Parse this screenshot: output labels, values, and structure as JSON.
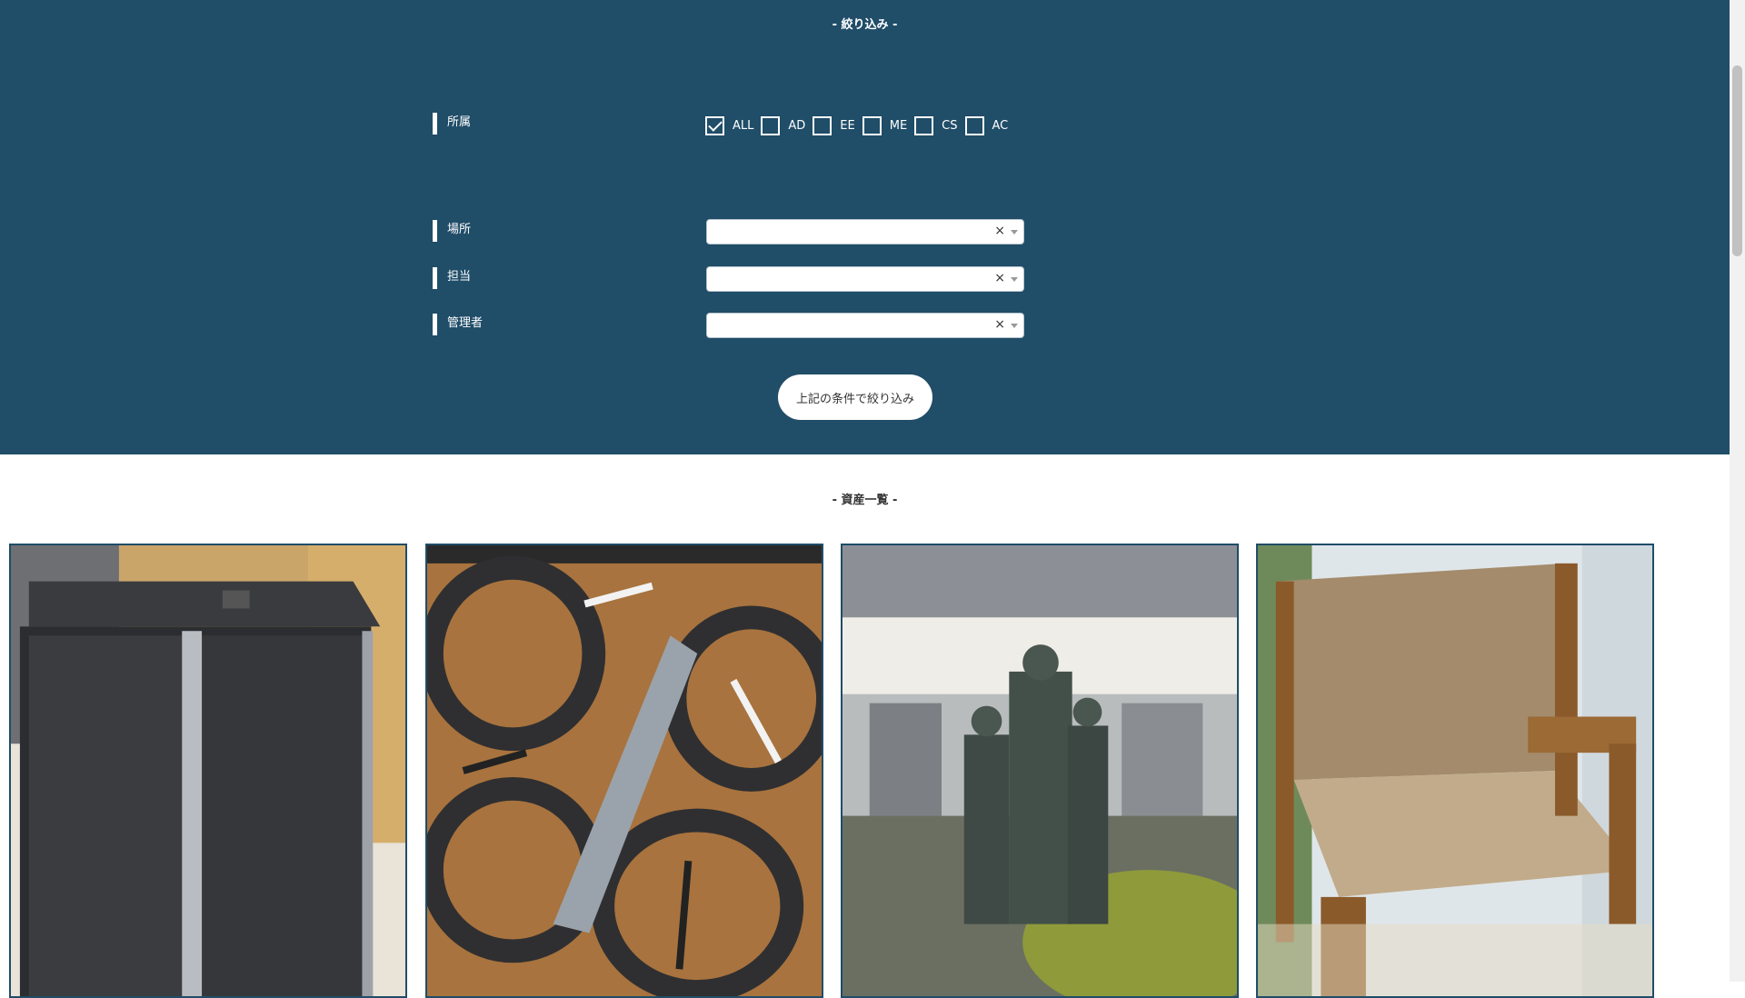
{
  "filter": {
    "title": "- 絞り込み -",
    "affiliation": {
      "label": "所属",
      "options": [
        {
          "label": "ALL",
          "checked": true
        },
        {
          "label": "AD",
          "checked": false
        },
        {
          "label": "EE",
          "checked": false
        },
        {
          "label": "ME",
          "checked": false
        },
        {
          "label": "CS",
          "checked": false
        },
        {
          "label": "AC",
          "checked": false
        }
      ]
    },
    "location": {
      "label": "場所",
      "value": "",
      "clear": "×"
    },
    "person_in_charge": {
      "label": "担当",
      "value": "",
      "clear": "×"
    },
    "manager": {
      "label": "管理者",
      "value": "",
      "clear": "×"
    },
    "submit_label": "上記の条件で絞り込み"
  },
  "assets": {
    "title": "- 資産一覧 -",
    "cards": [
      {
        "subject": "server-rack"
      },
      {
        "subject": "quadcopter-drone"
      },
      {
        "subject": "bronze-statue"
      },
      {
        "subject": "woven-chair"
      }
    ]
  },
  "colors": {
    "panel": "#204d68",
    "card_border": "#204d68"
  }
}
